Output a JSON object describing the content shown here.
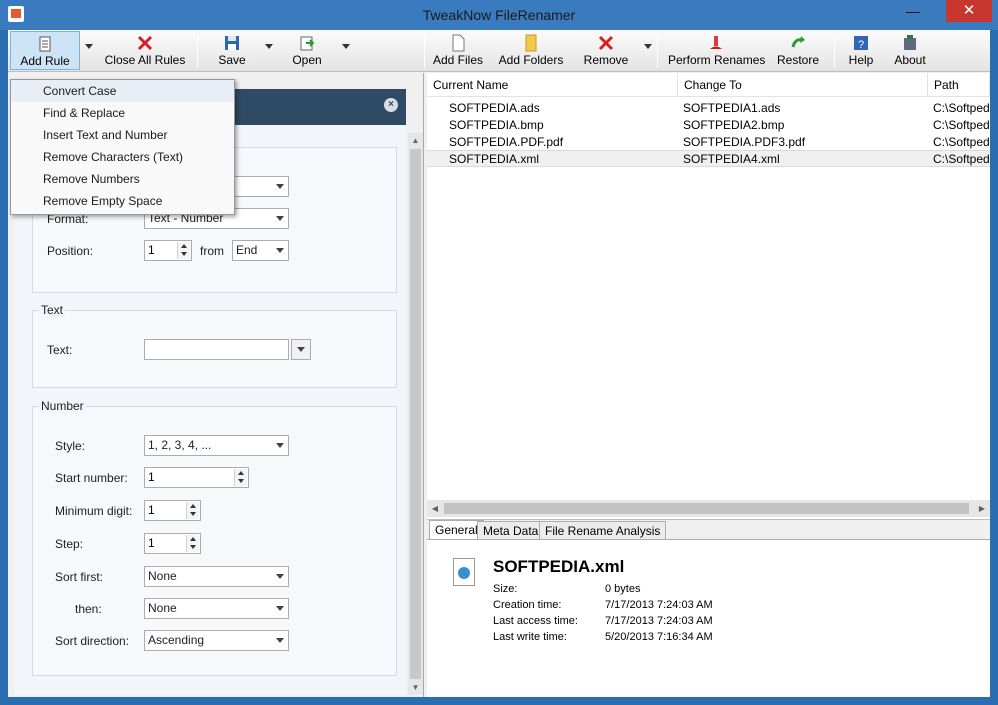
{
  "window": {
    "title": "TweakNow FileRenamer",
    "minimize": "—",
    "close": "✕"
  },
  "toolbar": {
    "add_rule": "Add Rule",
    "close_all_rules": "Close All Rules",
    "save": "Save",
    "open": "Open",
    "add_files": "Add Files",
    "add_folders": "Add Folders",
    "remove": "Remove",
    "perform_renames": "Perform Renames",
    "restore": "Restore",
    "help": "Help",
    "about": "About"
  },
  "add_rule_menu": {
    "items": [
      "Convert Case",
      "Find & Replace",
      "Insert Text and Number",
      "Remove Characters (Text)",
      "Remove Numbers",
      "Remove Empty Space"
    ]
  },
  "rule_panel": {
    "close": "×",
    "format_label": "Format:",
    "format_value": "Text - Number",
    "position_label": "Position:",
    "position_value": "1",
    "from_label": "from",
    "from_value": "End",
    "text_group": "Text",
    "text_label": "Text:",
    "number_group": "Number",
    "style_label": "Style:",
    "style_value": "1, 2, 3, 4, ...",
    "start_number_label": "Start number:",
    "start_number_value": "1",
    "min_digit_label": "Minimum digit:",
    "min_digit_value": "1",
    "step_label": "Step:",
    "step_value": "1",
    "sort_first_label": "Sort first:",
    "sort_first_value": "None",
    "then_label": "then:",
    "then_value": "None",
    "sort_direction_label": "Sort direction:",
    "sort_direction_value": "Ascending"
  },
  "file_list": {
    "columns": [
      "Current Name",
      "Change To",
      "Path"
    ],
    "rows": [
      {
        "current": "SOFTPEDIA.ads",
        "change_to": "SOFTPEDIA1.ads",
        "path": "C:\\Softpedia"
      },
      {
        "current": "SOFTPEDIA.bmp",
        "change_to": "SOFTPEDIA2.bmp",
        "path": "C:\\Softpedia"
      },
      {
        "current": "SOFTPEDIA.PDF.pdf",
        "change_to": "SOFTPEDIA.PDF3.pdf",
        "path": "C:\\Softpedia"
      },
      {
        "current": "SOFTPEDIA.xml",
        "change_to": "SOFTPEDIA4.xml",
        "path": "C:\\Softpedia"
      }
    ]
  },
  "detail_tabs": [
    "General",
    "Meta Data",
    "File Rename Analysis"
  ],
  "details": {
    "file_name": "SOFTPEDIA.xml",
    "size_label": "Size:",
    "size_value": "0 bytes",
    "creation_label": "Creation time:",
    "creation_value": "7/17/2013 7:24:03 AM",
    "access_label": "Last access time:",
    "access_value": "7/17/2013 7:24:03 AM",
    "write_label": "Last write time:",
    "write_value": "5/20/2013 7:16:34 AM"
  }
}
